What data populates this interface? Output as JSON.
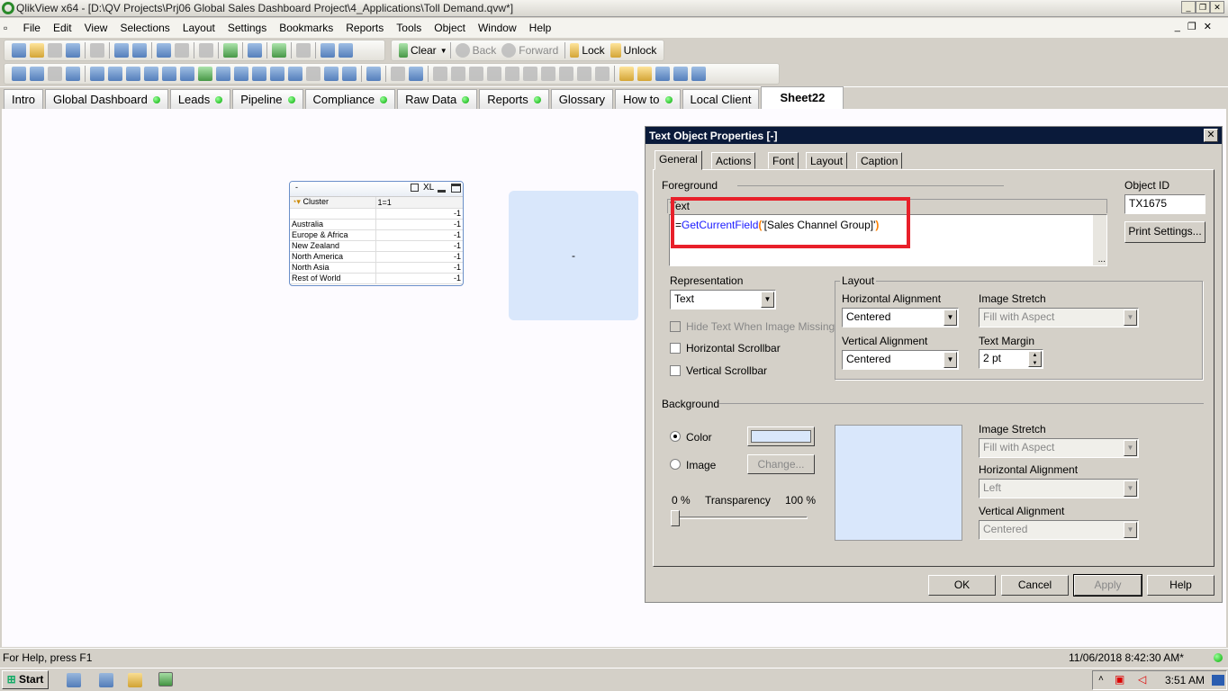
{
  "window": {
    "title": "QlikView x64 - [D:\\QV Projects\\Prj06 Global Sales Dashboard Project\\4_Applications\\Toll Demand.qvw*]"
  },
  "menu": [
    "File",
    "Edit",
    "View",
    "Selections",
    "Layout",
    "Settings",
    "Bookmarks",
    "Reports",
    "Tools",
    "Object",
    "Window",
    "Help"
  ],
  "toolbar1": {
    "icons": [
      "new-icon",
      "open-icon",
      "reload-icon",
      "save-icon",
      "print-icon",
      "edit-script-icon",
      "reload-data-icon",
      "undo-icon",
      "redo-icon",
      "search-icon",
      "selections-icon",
      "chart-wizard-icon",
      "bookmark-star-icon",
      "edit-icon",
      "help-icon",
      "context-help-icon"
    ],
    "clear": "Clear",
    "back": "Back",
    "forward": "Forward",
    "lock": "Lock",
    "unlock": "Unlock"
  },
  "toolbar2": {
    "icons": [
      "new-sheet-icon",
      "sheet-promote-icon",
      "sheet-demote-icon",
      "sheet-properties-icon",
      "listbox-icon",
      "statistics-box-icon",
      "table-box-icon",
      "multibox-icon",
      "chart-icon",
      "input-box-icon",
      "current-selections-icon",
      "button-icon",
      "text-object-icon",
      "line-arrow-icon",
      "slider-icon",
      "bookmark-object-icon",
      "search-object-icon",
      "container-icon",
      "custom-object-icon",
      "chart-wizard-icon",
      "format-painter-icon",
      "grid-icon",
      "align-left-icon",
      "align-center-icon",
      "align-right-icon",
      "align-bottom-icon",
      "center-horizontal-icon",
      "align-top-icon",
      "center-vertical-icon",
      "space-horizontal-icon",
      "space-horizontal-2-icon",
      "space-vertical-icon",
      "user-icon",
      "document-properties-icon",
      "edit-module-icon",
      "network-icon",
      "web-view-icon"
    ]
  },
  "tabs": [
    {
      "label": "Intro",
      "dot": false
    },
    {
      "label": "Global Dashboard",
      "dot": true
    },
    {
      "label": "Leads",
      "dot": true
    },
    {
      "label": "Pipeline",
      "dot": true
    },
    {
      "label": "Compliance",
      "dot": true
    },
    {
      "label": "Raw Data",
      "dot": true
    },
    {
      "label": "Reports",
      "dot": true
    },
    {
      "label": "Glossary",
      "dot": false
    },
    {
      "label": "How to",
      "dot": true
    },
    {
      "label": "Local Client",
      "dot": false
    },
    {
      "label": "Sheet22",
      "dot": false,
      "active": true
    }
  ],
  "tablebox": {
    "caption": "-",
    "caption_icons": [
      "print-icon",
      "xl-export-icon",
      "minimize-icon",
      "maximize-icon"
    ],
    "xl": "XL",
    "col1": "Cluster",
    "col2": "1=1",
    "rows": [
      {
        "c": "",
        "v": "-1"
      },
      {
        "c": "Australia",
        "v": "-1"
      },
      {
        "c": "Europe & Africa",
        "v": "-1"
      },
      {
        "c": "New Zealand",
        "v": "-1"
      },
      {
        "c": "North America",
        "v": "-1"
      },
      {
        "c": "North Asia",
        "v": "-1"
      },
      {
        "c": "Rest of World",
        "v": "-1"
      }
    ]
  },
  "textobject": {
    "text": "-"
  },
  "dialog": {
    "title": "Text Object Properties [-]",
    "tabs": [
      "General",
      "Actions",
      "Font",
      "Layout",
      "Caption"
    ],
    "foreground": "Foreground",
    "text_label": "Text",
    "expr": {
      "eq": "=",
      "fn": "GetCurrentField",
      "open": "(",
      "arg": "'[Sales Channel Group]'",
      "close": ")"
    },
    "object_id_label": "Object ID",
    "object_id": "TX1675",
    "print_settings": "Print Settings...",
    "representation_label": "Representation",
    "representation": "Text",
    "hide_text": "Hide Text When Image Missing",
    "hscroll": "Horizontal Scrollbar",
    "vscroll": "Vertical Scrollbar",
    "layout": {
      "title": "Layout",
      "h_align_label": "Horizontal Alignment",
      "h_align": "Centered",
      "v_align_label": "Vertical Alignment",
      "v_align": "Centered",
      "img_stretch_label": "Image Stretch",
      "img_stretch": "Fill with Aspect",
      "margin_label": "Text Margin",
      "margin": "2 pt"
    },
    "background": {
      "title": "Background",
      "color": "Color",
      "image": "Image",
      "change": "Change...",
      "tr_min": "0 %",
      "tr_label": "Transparency",
      "tr_max": "100 %",
      "transparency": 0,
      "swatch": "#d9e7fb",
      "img_stretch_label": "Image Stretch",
      "img_stretch": "Fill with Aspect",
      "h_align_label": "Horizontal Alignment",
      "h_align": "Left",
      "v_align_label": "Vertical Alignment",
      "v_align": "Centered"
    },
    "ok": "OK",
    "cancel": "Cancel",
    "apply": "Apply",
    "help": "Help"
  },
  "status": {
    "help": "For Help, press F1",
    "timestamp": "11/06/2018 8:42:30 AM*"
  },
  "taskbar": {
    "start": "Start",
    "clock": "3:51 AM"
  },
  "colors": {
    "highlight": "#e8202a",
    "function": "#1a1aff",
    "paren": "#ff8000"
  }
}
